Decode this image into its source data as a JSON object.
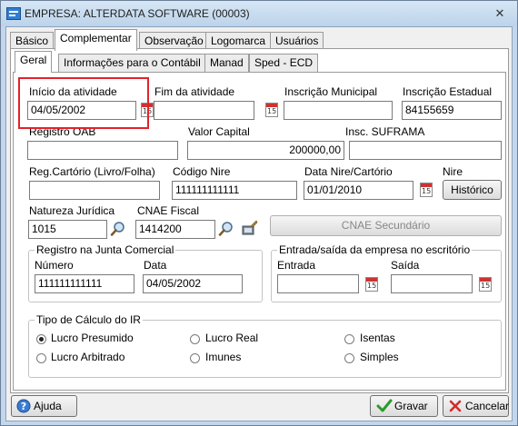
{
  "window": {
    "title": "EMPRESA: ALTERDATA SOFTWARE (00003)",
    "close": "✕"
  },
  "tabs": [
    "Básico",
    "Complementar",
    "Observação",
    "Logomarca",
    "Usuários"
  ],
  "subtabs": [
    "Geral",
    "Informações para o Contábil",
    "Manad",
    "Sped - ECD"
  ],
  "fields": {
    "inicio_atividade": {
      "label": "Início da atividade",
      "value": "04/05/2002"
    },
    "fim_atividade": {
      "label": "Fim da atividade",
      "value": ""
    },
    "inscricao_municipal": {
      "label": "Inscrição Municipal",
      "value": ""
    },
    "inscricao_estadual": {
      "label": "Inscrição Estadual",
      "value": "84155659"
    },
    "registro_oab": {
      "label": "Registro OAB",
      "value": ""
    },
    "valor_capital": {
      "label": "Valor Capital",
      "value": "200000,00"
    },
    "insc_suframa": {
      "label": "Insc. SUFRAMA",
      "value": ""
    },
    "reg_cartorio": {
      "label": "Reg.Cartório (Livro/Folha)",
      "value": ""
    },
    "codigo_nire": {
      "label": "Código Nire",
      "value": "111111111111"
    },
    "data_nire": {
      "label": "Data Nire/Cartório",
      "value": "01/01/2010"
    },
    "nire": {
      "label": "Nire",
      "button": "Histórico"
    },
    "natureza_juridica": {
      "label": "Natureza Jurídica",
      "value": "1015"
    },
    "cnae_fiscal": {
      "label": "CNAE Fiscal",
      "value": "1414200"
    },
    "cnae_secundario": {
      "button": "CNAE Secundário"
    }
  },
  "junta": {
    "title": "Registro na Junta Comercial",
    "numero_label": "Número",
    "numero_value": "111111111111",
    "data_label": "Data",
    "data_value": "04/05/2002"
  },
  "entrada_saida": {
    "title": "Entrada/saída da empresa no escritório",
    "entrada_label": "Entrada",
    "entrada_value": "",
    "saida_label": "Saída",
    "saida_value": ""
  },
  "ir": {
    "title": "Tipo de Cálculo do IR",
    "options": [
      "Lucro Presumido",
      "Lucro Real",
      "Isentas",
      "Lucro Arbitrado",
      "Imunes",
      "Simples"
    ],
    "selected": "Lucro Presumido"
  },
  "footer": {
    "help": "Ajuda",
    "save": "Gravar",
    "cancel": "Cancelar"
  },
  "calendar_glyph": "15"
}
